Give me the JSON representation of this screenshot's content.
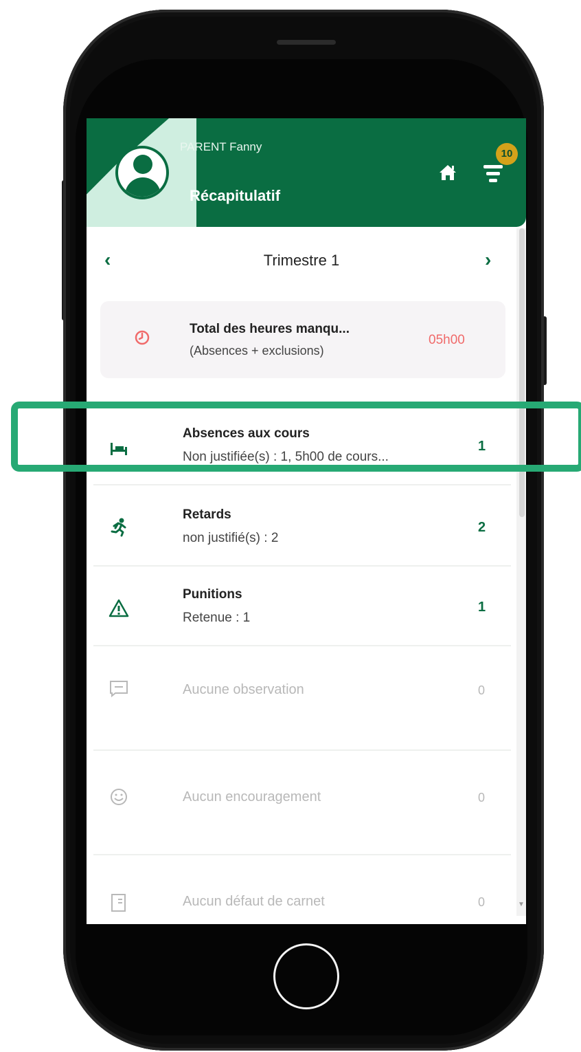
{
  "header": {
    "user_name": "PARENT Fanny",
    "page_title": "Récapitulatif",
    "notifications_count": "10",
    "accent_color": "#0a6d42",
    "badge_color": "#d4a21a"
  },
  "period_nav": {
    "title": "Trimestre 1",
    "prev_label": "‹",
    "next_label": "›"
  },
  "total": {
    "title": "Total des heures manqu...",
    "subtitle": "(Absences + exclusions)",
    "value": "05h00",
    "icon": "clock-icon"
  },
  "rows": [
    {
      "icon": "bed-icon",
      "title": "Absences aux cours",
      "subtitle": "Non justifiée(s) : 1, 5h00 de cours...",
      "count": "1"
    },
    {
      "icon": "running-person-icon",
      "title": "Retards",
      "subtitle": "non justifié(s) : 2",
      "count": "2"
    },
    {
      "icon": "warning-icon",
      "title": "Punitions",
      "subtitle": "Retenue : 1",
      "count": "1"
    },
    {
      "icon": "comment-icon",
      "title": "Aucune observation",
      "count": "0"
    },
    {
      "icon": "smiley-icon",
      "title": "Aucun encouragement",
      "count": "0"
    },
    {
      "icon": "notebook-icon",
      "title": "Aucun défaut de carnet",
      "count": "0"
    }
  ]
}
